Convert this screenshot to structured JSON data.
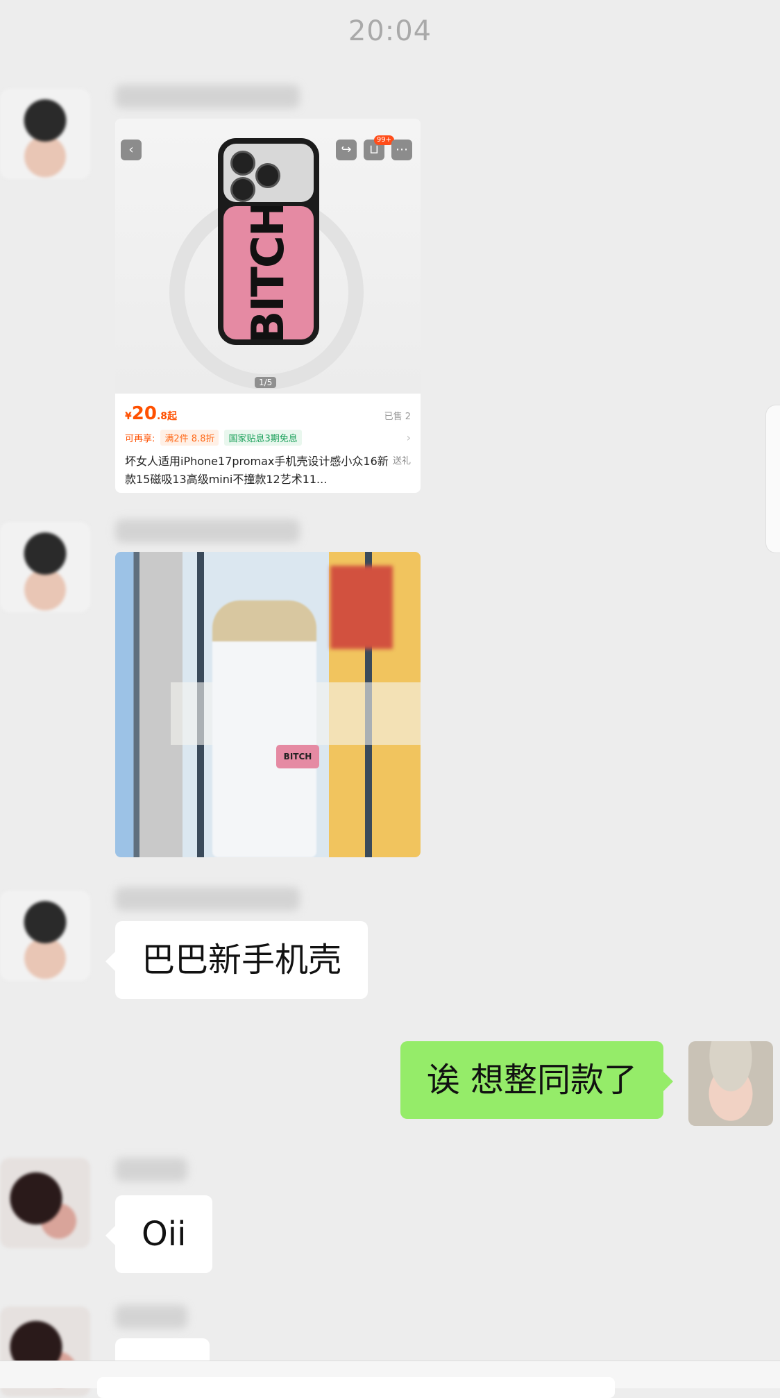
{
  "timestamp": "20:04",
  "messages": {
    "product_card": {
      "price_symbol": "¥",
      "price_int": "20",
      "price_dec": ".8起",
      "sold": "已售 2",
      "tag_enjoy": "可再享:",
      "tag_discount": "满2件 8.8折",
      "tag_subsidy": "国家贴息3期免息",
      "title": "坏女人适用iPhone17promax手机壳设计感小众16新款15磁吸13高级mini不撞款12艺术11...",
      "gift": "送礼",
      "pager": "1/5",
      "cart_badge": "99+",
      "case_text": "BITCH"
    },
    "photo_case_text": "BITCH",
    "text_1": "巴巴新手机壳",
    "text_me": "诶 想整同款了",
    "text_2": "Oii"
  }
}
